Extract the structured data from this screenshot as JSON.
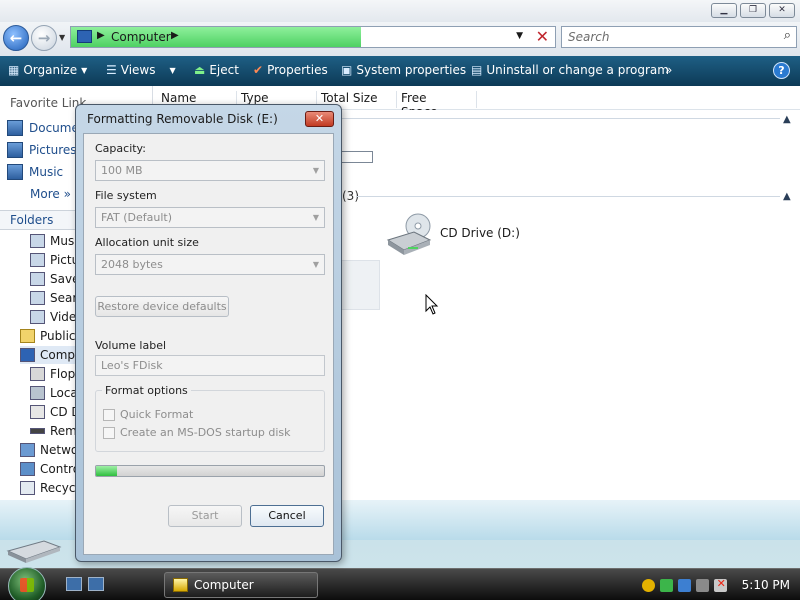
{
  "window": {
    "minimize": "▁",
    "maximize": "❐",
    "close": "✕"
  },
  "address": {
    "path": "Computer",
    "progress": 0.6
  },
  "search": {
    "placeholder": "Search"
  },
  "toolbar": {
    "organize": "Organize",
    "views": "Views",
    "eject": "Eject",
    "properties": "Properties",
    "system_properties": "System properties",
    "uninstall": "Uninstall or change a program",
    "more": "»",
    "help": "?"
  },
  "navpane": {
    "favorites_header": "Favorite Link",
    "favorites": [
      "Docume",
      "Pictures",
      "Music"
    ],
    "more": "More »",
    "folders_header": "Folders",
    "tree": [
      {
        "label": "Mus",
        "indent": 1
      },
      {
        "label": "Pictu",
        "indent": 1
      },
      {
        "label": "Save",
        "indent": 1
      },
      {
        "label": "Sear",
        "indent": 1
      },
      {
        "label": "Vide",
        "indent": 1
      },
      {
        "label": "Public",
        "indent": 0
      },
      {
        "label": "Comp",
        "indent": 0
      },
      {
        "label": "Flop",
        "indent": 1
      },
      {
        "label": "Loca",
        "indent": 1
      },
      {
        "label": "CD D",
        "indent": 1
      },
      {
        "label": "Rem",
        "indent": 1
      },
      {
        "label": "Netwo",
        "indent": 0
      },
      {
        "label": "Contro",
        "indent": 0
      },
      {
        "label": "Recycl",
        "indent": 0
      }
    ]
  },
  "columns": [
    "Name",
    "Type",
    "Total Size",
    "Free Space"
  ],
  "content": {
    "group_count": "(3)",
    "cd_drive": "CD Drive (D:)"
  },
  "dialog": {
    "title": "Formatting Removable Disk (E:)",
    "close": "✕",
    "capacity_label": "Capacity:",
    "capacity_value": "100 MB",
    "filesystem_label": "File system",
    "filesystem_value": "FAT (Default)",
    "allocation_label": "Allocation unit size",
    "allocation_value": "2048 bytes",
    "restore_defaults": "Restore device defaults",
    "volume_label": "Volume label",
    "volume_value": "Leo's FDisk",
    "format_options": "Format options",
    "quick_format": "Quick Format",
    "msdos_disk": "Create an MS-DOS startup disk",
    "progress": 0.09,
    "start": "Start",
    "cancel": "Cancel"
  },
  "taskbar": {
    "task": "Computer",
    "clock": "5:10 PM"
  }
}
